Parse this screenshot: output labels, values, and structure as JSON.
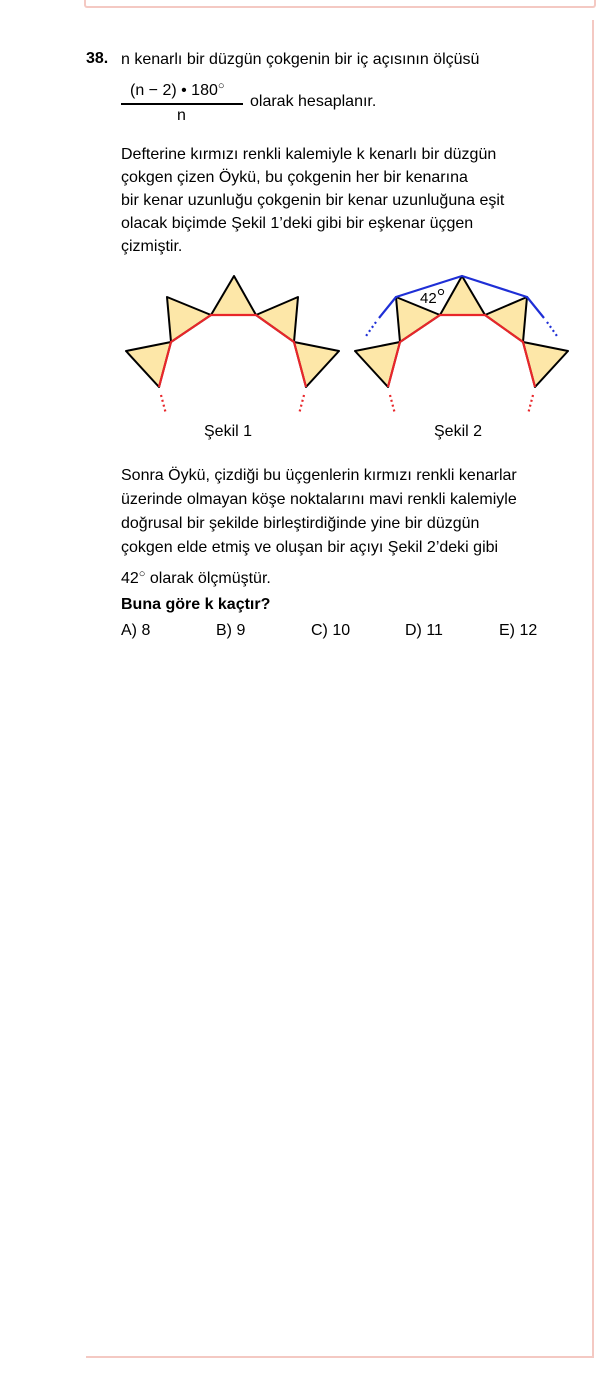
{
  "question": {
    "number": "38.",
    "intro": "n kenarlı bir düzgün çokgenin bir iç açısının ölçüsü",
    "formula_numerator": "(n − 2) • 180",
    "formula_denominator": "n",
    "formula_after": "olarak hesaplanır.",
    "para1": [
      "Defterine kırmızı renkli kalemiyle k kenarlı bir düzgün",
      "çokgen çizen Öykü, bu çokgenin her bir kenarına",
      "bir kenar uzunluğu çokgenin bir kenar uzunluğuna eşit",
      "olacak biçimde Şekil 1’deki gibi bir eşkenar üçgen",
      "çizmiştir."
    ],
    "figure1_caption": "Şekil 1",
    "figure2_caption": "Şekil 2",
    "figure2_angle": "42",
    "para2": [
      "Sonra Öykü, çizdiği bu üçgenlerin kırmızı renkli kenarlar",
      "üzerinde olmayan köşe noktalarını mavi renkli kalemiyle",
      "doğrusal bir şekilde birleştirdiğinde yine bir düzgün",
      "çokgen elde etmiş ve oluşan bir açıyı Şekil 2’deki gibi"
    ],
    "para2_last_value": "42",
    "para2_last_rest": "olarak ölçmüştür.",
    "ask": "Buna göre  k  kaçtır?",
    "options": [
      "A) 8",
      "B) 9",
      "C) 10",
      "D) 11",
      "E) 12"
    ]
  },
  "colors": {
    "polygon_edge": "#e8262a",
    "triangle_fill": "#fde7a8",
    "blue_line": "#1f2fd6",
    "frame": "#f4c9c3"
  }
}
